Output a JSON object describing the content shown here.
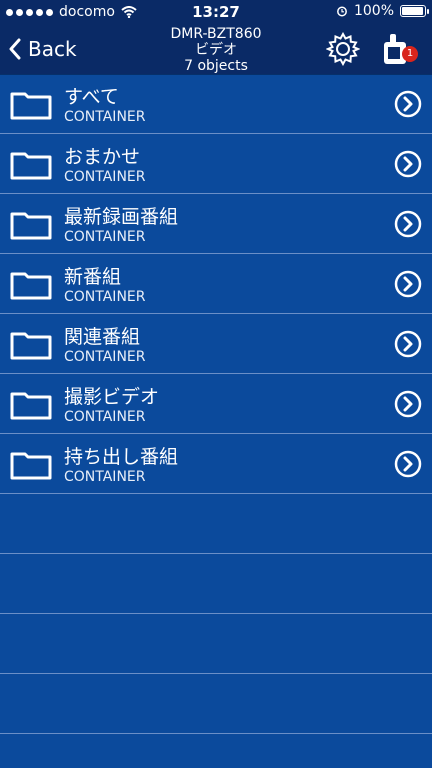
{
  "status_bar": {
    "carrier": "docomo",
    "time": "13:27",
    "battery": "100%",
    "battery_level": 1.0
  },
  "nav": {
    "back_label": "Back",
    "title_line1": "DMR-BZT860",
    "title_line2": "ビデオ",
    "title_line3": "7 objects",
    "badge_count": "1"
  },
  "items": [
    {
      "title": "すべて",
      "subtitle": "CONTAINER"
    },
    {
      "title": "おまかせ",
      "subtitle": "CONTAINER"
    },
    {
      "title": "最新録画番組",
      "subtitle": "CONTAINER"
    },
    {
      "title": "新番組",
      "subtitle": "CONTAINER"
    },
    {
      "title": "関連番組",
      "subtitle": "CONTAINER"
    },
    {
      "title": "撮影ビデオ",
      "subtitle": "CONTAINER"
    },
    {
      "title": "持ち出し番組",
      "subtitle": "CONTAINER"
    }
  ],
  "colors": {
    "background": "#0b4a9c",
    "nav_background": "#0a2a66",
    "badge": "#d9251c"
  }
}
